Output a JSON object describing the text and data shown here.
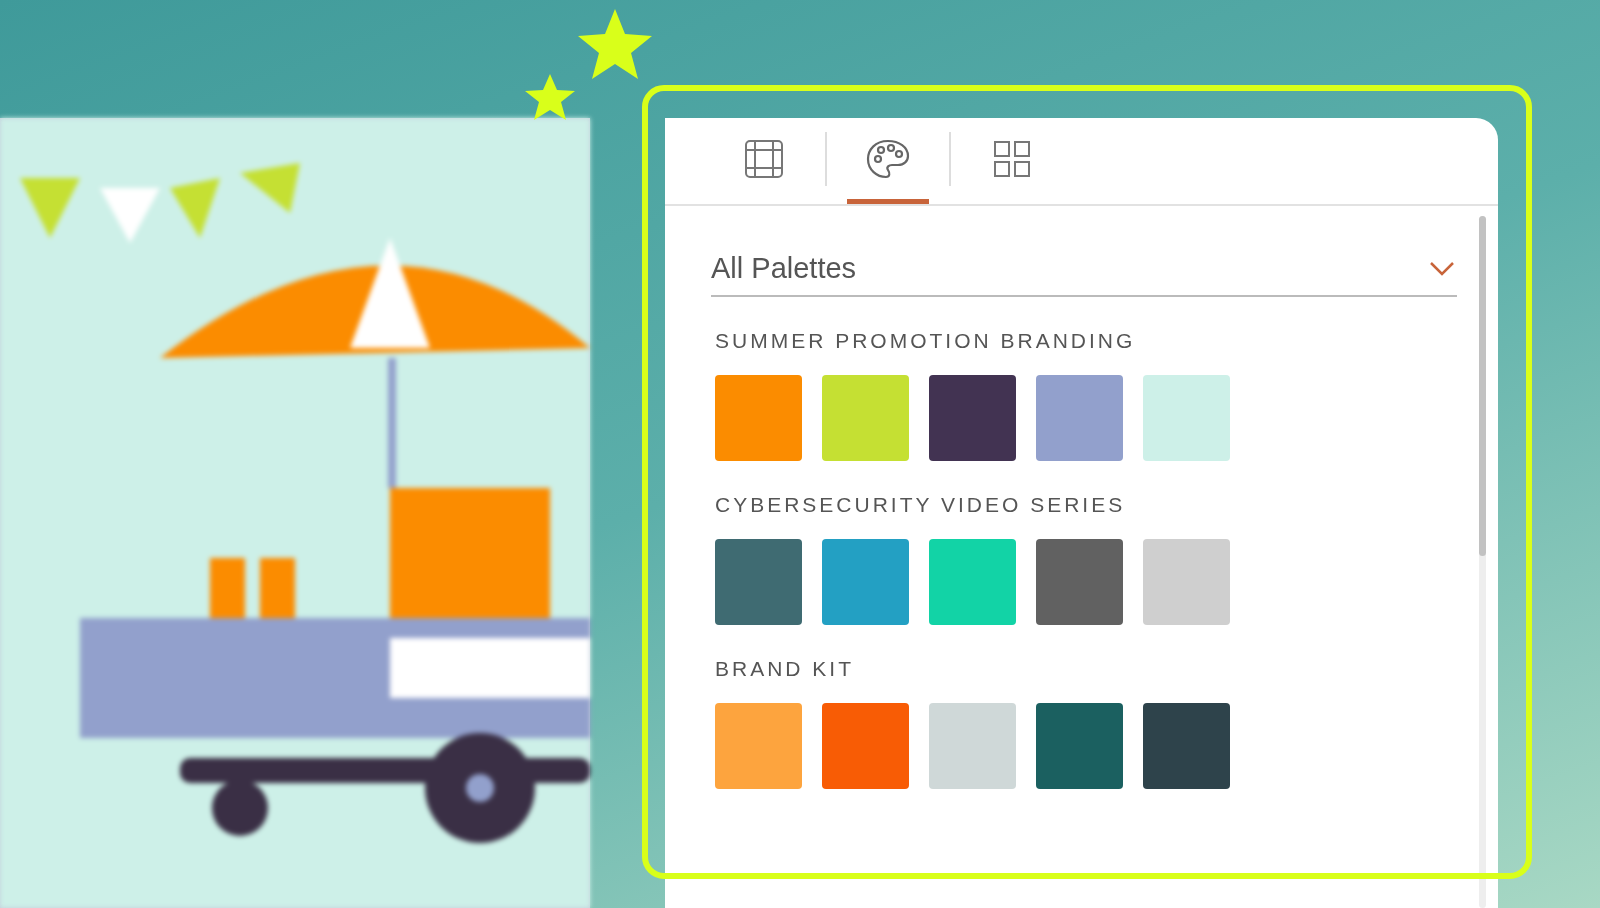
{
  "tabs": [
    {
      "kind": "table",
      "selected": false
    },
    {
      "kind": "palette",
      "selected": true
    },
    {
      "kind": "layout",
      "selected": false
    }
  ],
  "palette_filter": {
    "value": "All Palettes"
  },
  "palettes": [
    {
      "name": "SUMMER PROMOTION BRANDING",
      "swatches": [
        {
          "color": "#fb8c00"
        },
        {
          "color": "#c5e033"
        },
        {
          "color": "#423352"
        },
        {
          "color": "#92a0cc"
        },
        {
          "color": "#cdf0e8"
        }
      ]
    },
    {
      "name": "CYBERSECURITY VIDEO SERIES",
      "swatches": [
        {
          "color": "#3f6b72"
        },
        {
          "color": "#23a0c3"
        },
        {
          "color": "#12d3a6"
        },
        {
          "color": "#616161"
        },
        {
          "color": "#cfcfcf"
        }
      ]
    },
    {
      "name": "BRAND KIT",
      "swatches": [
        {
          "color": "#fda43e"
        },
        {
          "color": "#f85c05"
        },
        {
          "color": "#cfd8d8"
        },
        {
          "color": "#1b6060"
        },
        {
          "color": "#2e434b"
        }
      ]
    }
  ]
}
